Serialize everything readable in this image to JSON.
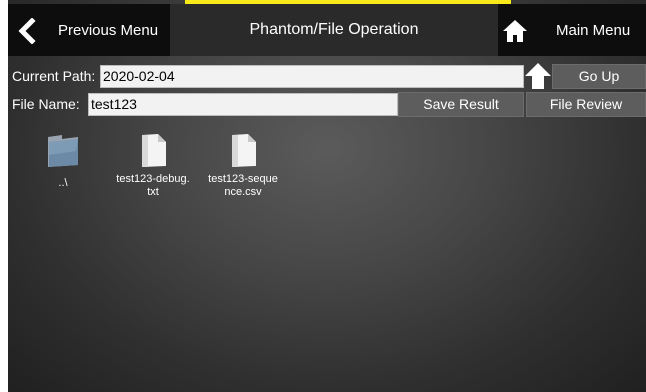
{
  "header": {
    "previous_menu_label": "Previous Menu",
    "title": "Phantom/File Operation",
    "main_menu_label": "Main Menu"
  },
  "path_row": {
    "current_path_label": "Current Path:",
    "current_path_value": "2020-02-04",
    "go_up_label": "Go Up"
  },
  "file_row": {
    "file_name_label": "File Name:",
    "file_name_value": "test123",
    "save_result_label": "Save Result",
    "file_review_label": "File Review"
  },
  "files": [
    {
      "icon": "folder-icon",
      "name_line1": "..\\",
      "name_line2": ""
    },
    {
      "icon": "document-icon",
      "name_line1": "test123-debug.",
      "name_line2": "txt"
    },
    {
      "icon": "document-icon",
      "name_line1": "test123-seque",
      "name_line2": "nce.csv"
    }
  ],
  "colors": {
    "accent_strip": "#f7ea18",
    "header_dark": "#0d0d0d",
    "button": "#5d5d5d"
  }
}
